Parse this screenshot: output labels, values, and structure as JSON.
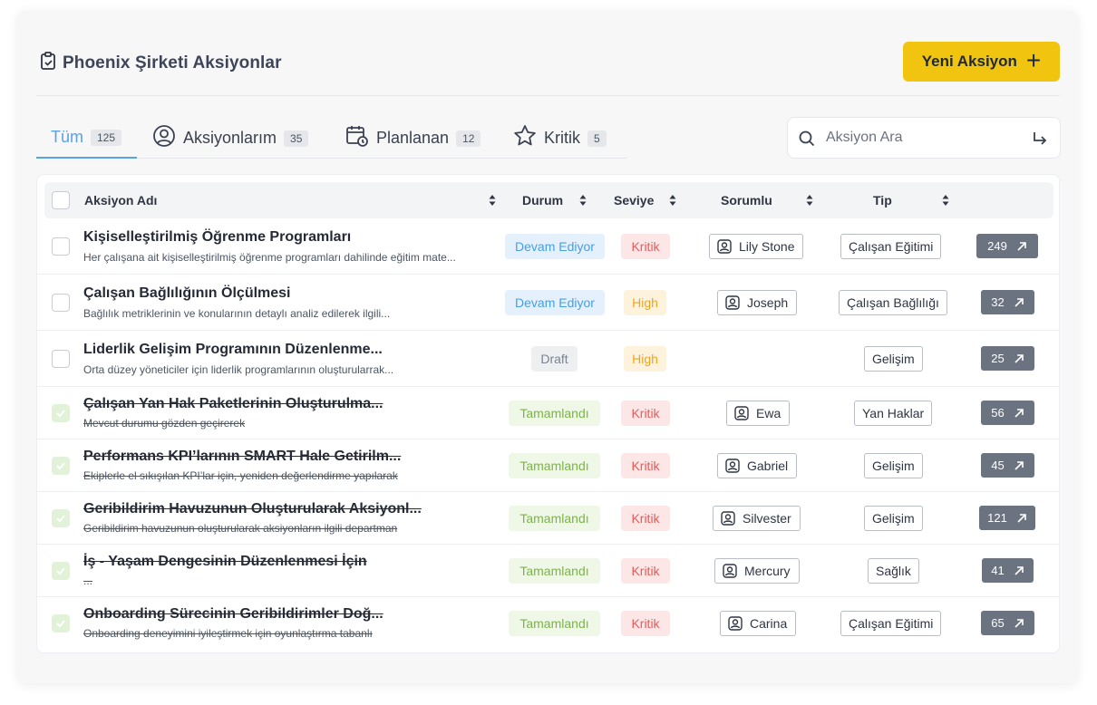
{
  "header": {
    "title": "Phoenix Şirketi Aksiyonlar",
    "new_button_label": "Yeni Aksiyon",
    "new_button_color": "#f1c40f"
  },
  "tabs": [
    {
      "label": "Tüm",
      "count": "125",
      "icon": "none",
      "active": true
    },
    {
      "label": "Aksiyonlarım",
      "count": "35",
      "icon": "user-circle-icon"
    },
    {
      "label": "Planlanan",
      "count": "12",
      "icon": "calendar-clock-icon"
    },
    {
      "label": "Kritik",
      "count": "5",
      "icon": "star-icon"
    }
  ],
  "search": {
    "placeholder": "Aksiyon Ara"
  },
  "columns": {
    "name": "Aksiyon Adı",
    "status": "Durum",
    "level": "Seviye",
    "owner": "Sorumlu",
    "type": "Tip"
  },
  "rows": [
    {
      "title": "Kişiselleştirilmiş Öğrenme Programları",
      "desc": "Her çalışana ait kişiselleştirilmiş öğrenme programları dahilinde eğitim mate...",
      "status": "Devam Ediyor",
      "level": "Kritik",
      "owner": "Lily Stone",
      "type": "Çalışan Eğitimi",
      "count": "249",
      "done": false
    },
    {
      "title": "Çalışan Bağlılığının Ölçülmesi",
      "desc": "Bağlılık metriklerinin ve konularının detaylı analiz edilerek ilgili...",
      "status": "Devam Ediyor",
      "level": "High",
      "owner": "Joseph",
      "type": "Çalışan Bağlılığı",
      "count": "32",
      "done": false
    },
    {
      "title": "Liderlik Gelişim Programının Düzenlenme...",
      "desc": "Orta düzey yöneticiler için liderlik programlarının oluşturularrak...",
      "status": "Draft",
      "level": "High",
      "owner": "",
      "type": "Gelişim",
      "count": "25",
      "done": false
    },
    {
      "title": "Çalışan Yan Hak Paketlerinin Oluşturulma...",
      "desc": "Mevcut durumu gözden geçirerek",
      "status": "Tamamlandı",
      "level": "Kritik",
      "owner": "Ewa",
      "type": "Yan Haklar",
      "count": "56",
      "done": true
    },
    {
      "title": "Performans KPI’larının SMART Hale Getirilm...",
      "desc": "Ekiplerle el sıkışılan KPI’lar için, yeniden değerlendirme yapılarak",
      "status": "Tamamlandı",
      "level": "Kritik",
      "owner": "Gabriel",
      "type": "Gelişim",
      "count": "45",
      "done": true
    },
    {
      "title": "Geribildirim Havuzunun Oluşturularak Aksiyonl...",
      "desc": "Geribildirim havuzunun oluşturularak aksiyonların ilgili departman",
      "status": "Tamamlandı",
      "level": "Kritik",
      "owner": "Silvester",
      "type": "Gelişim",
      "count": "121",
      "done": true
    },
    {
      "title": "İş - Yaşam Dengesinin Düzenlenmesi İçin",
      "desc": "...",
      "status": "Tamamlandı",
      "level": "Kritik",
      "owner": "Mercury",
      "type": "Sağlık",
      "count": "41",
      "done": true
    },
    {
      "title": "Onboarding Sürecinin Geribildirimler Doğ...",
      "desc": "Onboarding deneyimini iyileştirmek için oyunlaştırma tabanlı",
      "status": "Tamamlandı",
      "level": "Kritik",
      "owner": "Carina",
      "type": "Çalışan Eğitimi",
      "count": "65",
      "done": true
    }
  ]
}
